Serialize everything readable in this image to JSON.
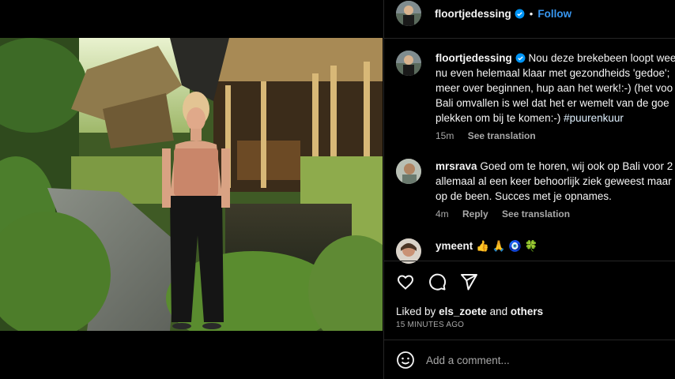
{
  "post": {
    "username": "floortjedessing",
    "follow_label": "Follow",
    "separator": "•"
  },
  "caption": {
    "username": "floortjedessing",
    "lines": [
      "Nou deze brekebeen loopt wee",
      "nu even helemaal klaar met gezondheids 'gedoe';",
      "meer over beginnen, hup aan het werk!:-) (het voo",
      "Bali omvallen is wel dat het er wemelt van de goe",
      "plekken om bij te komen:-)"
    ],
    "hashtag": "#puurenkuur",
    "time": "15m",
    "see_translation": "See translation"
  },
  "comments": [
    {
      "username": "mrsrava",
      "lines": [
        "Goed om te horen, wij ook op Bali voor 2",
        "allemaal al een keer behoorlijk ziek geweest maar",
        "op de been. Succes met je opnames."
      ],
      "time": "4m",
      "reply": "Reply",
      "see_translation": "See translation"
    },
    {
      "username": "ymeent",
      "text": "👍 🙏 🧿 🍀"
    }
  ],
  "likes": {
    "prefix": "Liked by",
    "user": "els_zoete",
    "and": "and",
    "others": "others"
  },
  "timestamp": "15 MINUTES AGO",
  "add_comment": {
    "placeholder": "Add a comment..."
  },
  "colors": {
    "link": "#3897f0",
    "verified": "#0095f6",
    "background": "#000000"
  },
  "icons": [
    "heart-icon",
    "comment-icon",
    "share-icon",
    "emoji-icon",
    "verified-badge-icon"
  ]
}
